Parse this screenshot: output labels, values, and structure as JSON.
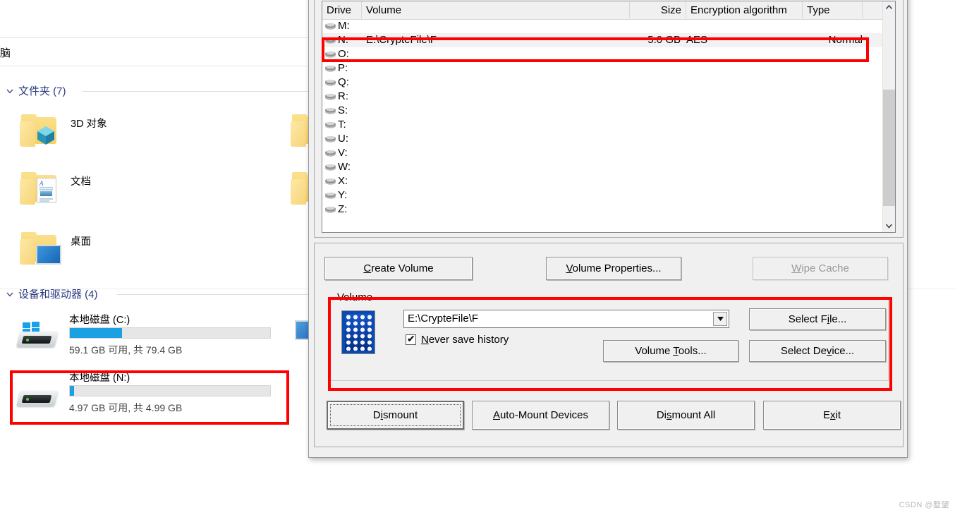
{
  "explorer": {
    "breadcrumb": "脑",
    "groups": [
      {
        "label": "文件夹 (7)",
        "count": 7
      },
      {
        "label": "设备和驱动器 (4)",
        "count": 4
      }
    ],
    "folders": [
      {
        "name": "3D 对象",
        "icon": "folder-3d-objects-icon"
      },
      {
        "name": "文档",
        "icon": "folder-documents-icon"
      },
      {
        "name": "桌面",
        "icon": "folder-desktop-icon"
      }
    ],
    "drives": [
      {
        "name": "本地磁盘 (C:)",
        "usage_text": "59.1 GB 可用, 共 79.4 GB",
        "fill_percent": 26,
        "icon": "windows-drive-icon"
      },
      {
        "name": "本地磁盘 (N:)",
        "usage_text": "4.97 GB 可用, 共 4.99 GB",
        "fill_percent": 2,
        "icon": "local-drive-icon"
      }
    ]
  },
  "veracrypt": {
    "list": {
      "columns": [
        {
          "key": "drive",
          "label": "Drive"
        },
        {
          "key": "volume",
          "label": "Volume"
        },
        {
          "key": "size",
          "label": "Size"
        },
        {
          "key": "encryption",
          "label": "Encryption algorithm"
        },
        {
          "key": "type",
          "label": "Type"
        }
      ],
      "rows": [
        {
          "drive": "M:",
          "volume": "",
          "size": "",
          "encryption": "",
          "type": "",
          "selected": false
        },
        {
          "drive": "N:",
          "volume": "E:\\CrypteFile\\F",
          "size": "5.0 GB",
          "encryption": "AES",
          "type": "Normal",
          "selected": true
        },
        {
          "drive": "O:",
          "volume": "",
          "size": "",
          "encryption": "",
          "type": "",
          "selected": false
        },
        {
          "drive": "P:",
          "volume": "",
          "size": "",
          "encryption": "",
          "type": "",
          "selected": false
        },
        {
          "drive": "Q:",
          "volume": "",
          "size": "",
          "encryption": "",
          "type": "",
          "selected": false
        },
        {
          "drive": "R:",
          "volume": "",
          "size": "",
          "encryption": "",
          "type": "",
          "selected": false
        },
        {
          "drive": "S:",
          "volume": "",
          "size": "",
          "encryption": "",
          "type": "",
          "selected": false
        },
        {
          "drive": "T:",
          "volume": "",
          "size": "",
          "encryption": "",
          "type": "",
          "selected": false
        },
        {
          "drive": "U:",
          "volume": "",
          "size": "",
          "encryption": "",
          "type": "",
          "selected": false
        },
        {
          "drive": "V:",
          "volume": "",
          "size": "",
          "encryption": "",
          "type": "",
          "selected": false
        },
        {
          "drive": "W:",
          "volume": "",
          "size": "",
          "encryption": "",
          "type": "",
          "selected": false
        },
        {
          "drive": "X:",
          "volume": "",
          "size": "",
          "encryption": "",
          "type": "",
          "selected": false
        },
        {
          "drive": "Y:",
          "volume": "",
          "size": "",
          "encryption": "",
          "type": "",
          "selected": false
        },
        {
          "drive": "Z:",
          "volume": "",
          "size": "",
          "encryption": "",
          "type": "",
          "selected": false
        }
      ]
    },
    "actions": {
      "create_volume": {
        "pre": "C",
        "post": "reate Volume"
      },
      "volume_properties": {
        "pre": "V",
        "post": "olume Properties..."
      },
      "wipe_cache": {
        "pre": "W",
        "post": "ipe Cache",
        "disabled": true
      }
    },
    "volume_group": {
      "title": "Volume",
      "path_value": "E:\\CrypteFile\\F",
      "never_save_history": {
        "pre": "N",
        "post": "ever save history",
        "checked": true
      },
      "select_file": {
        "pre_a": "Select F",
        "pre": "i",
        "post": "le..."
      },
      "select_device": {
        "pre_a": "Select De",
        "pre": "v",
        "post": "ice..."
      },
      "volume_tools": {
        "pre_a": "Volume ",
        "pre": "T",
        "post": "ools..."
      }
    },
    "bottom": {
      "dismount": {
        "pre_a": "D",
        "pre": "i",
        "post": "smount"
      },
      "auto_mount": {
        "pre": "A",
        "post": "uto-Mount Devices"
      },
      "dismount_all": {
        "pre_a": "Di",
        "pre": "s",
        "post": "mount All"
      },
      "exit": {
        "pre_a": "E",
        "pre": "x",
        "post": "it"
      }
    }
  },
  "watermark": "CSDN @墅望",
  "colors": {
    "accent_blue": "#1ba1e2",
    "highlight_red": "#ff0000",
    "dialog_bg": "#f0f0f0",
    "group_label_blue": "#2a3a80"
  }
}
